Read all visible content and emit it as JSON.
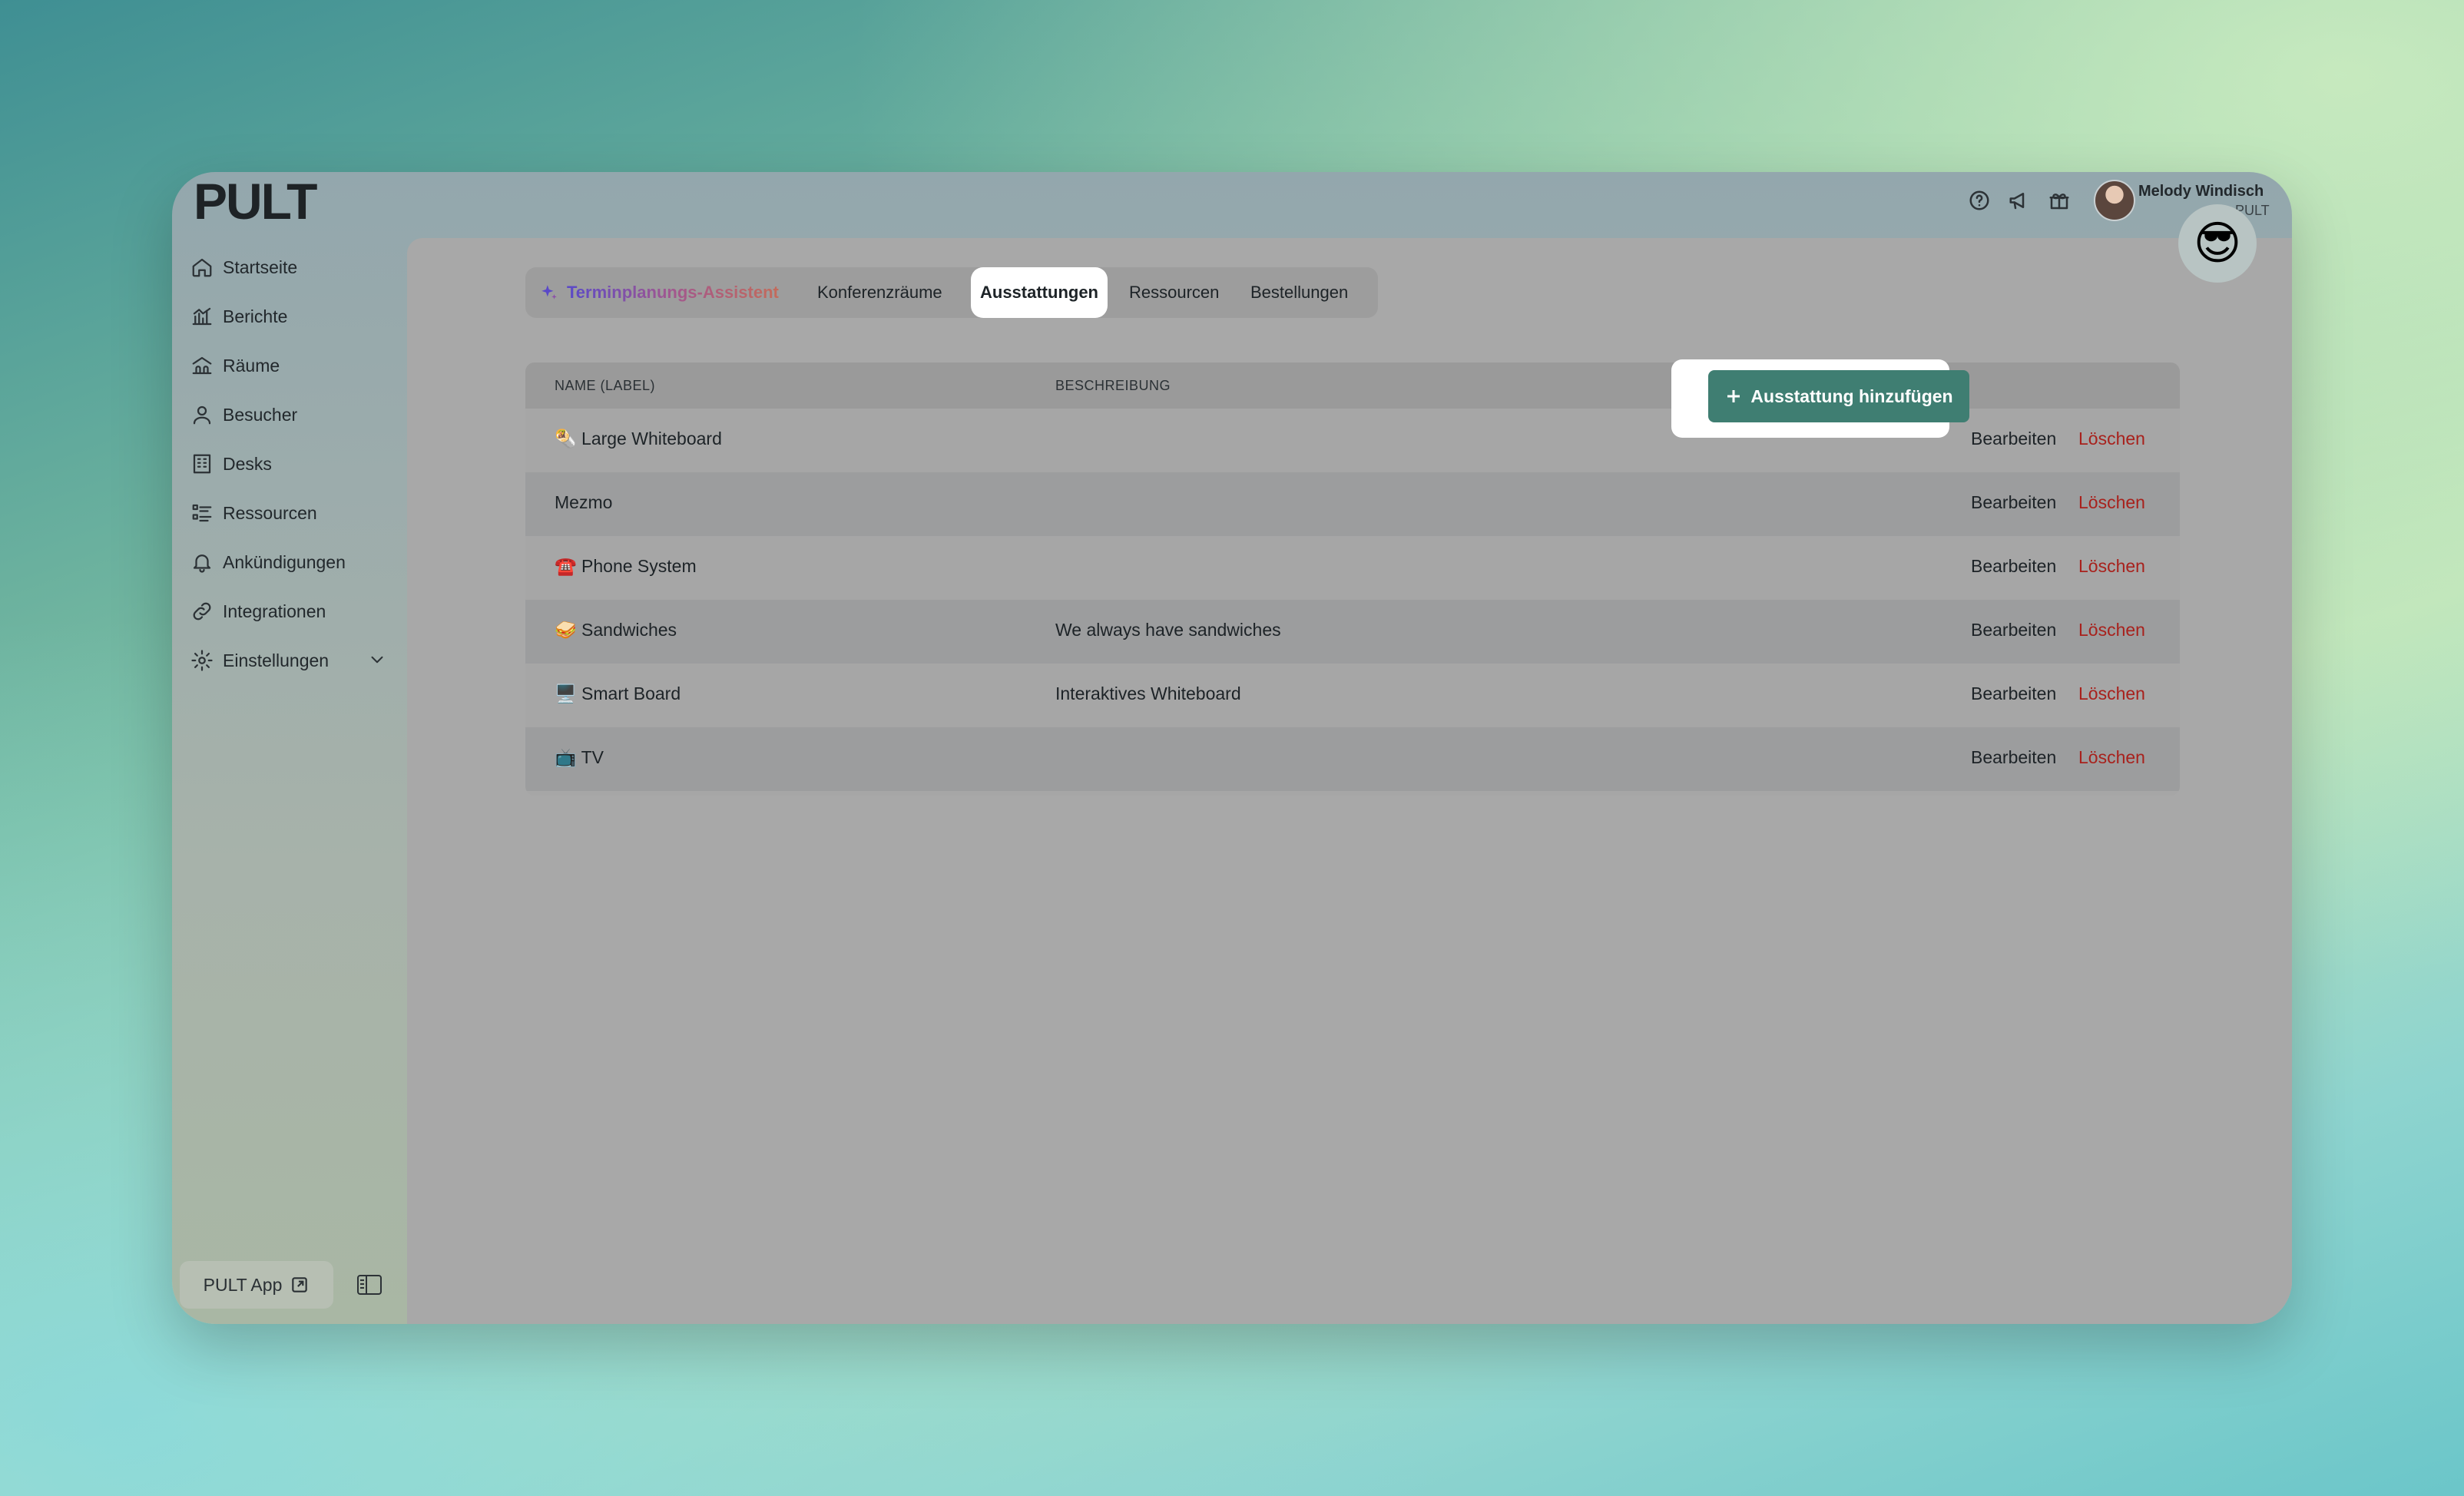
{
  "brand": {
    "name": "PULT"
  },
  "sidebar": {
    "items": [
      {
        "label": "Startseite",
        "icon": "home-icon"
      },
      {
        "label": "Berichte",
        "icon": "chart-icon"
      },
      {
        "label": "Räume",
        "icon": "rooms-icon"
      },
      {
        "label": "Besucher",
        "icon": "user-icon"
      },
      {
        "label": "Desks",
        "icon": "building-icon"
      },
      {
        "label": "Ressourcen",
        "icon": "list-icon"
      },
      {
        "label": "Ankündigungen",
        "icon": "bell-icon"
      },
      {
        "label": "Integrationen",
        "icon": "link-icon"
      },
      {
        "label": "Einstellungen",
        "icon": "gear-icon"
      }
    ],
    "app_button": "PULT App"
  },
  "header": {
    "user_name": "Melody Windisch",
    "user_org": "PULT"
  },
  "tabs": [
    {
      "label": "Terminplanungs-Assistent"
    },
    {
      "label": "Konferenzräume"
    },
    {
      "label": "Ausstattungen"
    },
    {
      "label": "Ressourcen"
    },
    {
      "label": "Bestellungen"
    }
  ],
  "actions": {
    "add_label": "Ausstattung hinzufügen"
  },
  "table": {
    "columns": [
      "NAME (LABEL)",
      "BESCHREIBUNG"
    ],
    "edit_label": "Bearbeiten",
    "delete_label": "Löschen",
    "rows": [
      {
        "name": "🌯 Large Whiteboard",
        "description": ""
      },
      {
        "name": "Mezmo",
        "description": ""
      },
      {
        "name": "☎️ Phone System",
        "description": ""
      },
      {
        "name": "🥪 Sandwiches",
        "description": "We always have sandwiches"
      },
      {
        "name": "🖥️ Smart Board",
        "description": "Interaktives Whiteboard"
      },
      {
        "name": "📺 TV",
        "description": ""
      }
    ]
  },
  "emoji_bubble": "😎",
  "colors": {
    "accent": "#3f7e72",
    "delete": "#a8211c"
  }
}
